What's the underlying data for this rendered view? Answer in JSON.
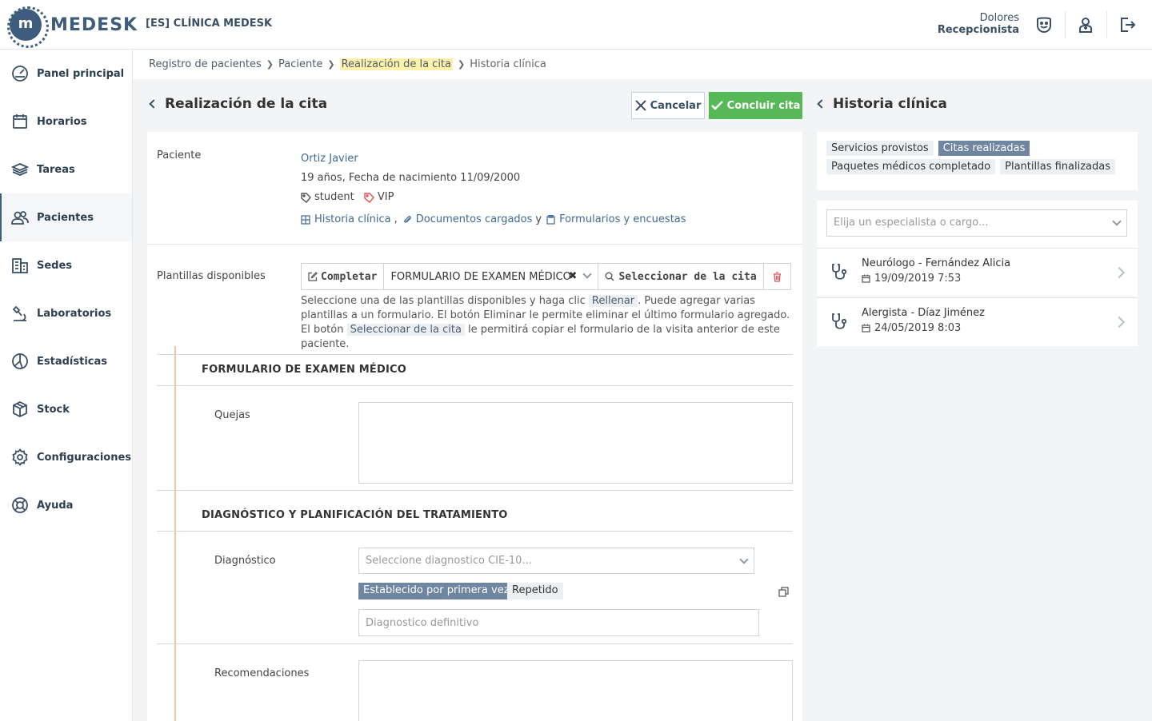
{
  "brand": {
    "logo_text": "MEDESK",
    "logo_mark": "m"
  },
  "header": {
    "clinic": "[ES] CLÍNICA MEDESK",
    "user_name": "Dolores",
    "user_role": "Recepcionista"
  },
  "sidebar": {
    "items": [
      {
        "label": "Panel principal",
        "icon": "dashboard-icon"
      },
      {
        "label": "Horarios",
        "icon": "calendar-icon"
      },
      {
        "label": "Tareas",
        "icon": "layers-icon"
      },
      {
        "label": "Pacientes",
        "icon": "patients-icon",
        "active": true
      },
      {
        "label": "Sedes",
        "icon": "buildings-icon"
      },
      {
        "label": "Laboratorios",
        "icon": "lab-icon"
      },
      {
        "label": "Estadísticas",
        "icon": "stats-icon"
      },
      {
        "label": "Stock",
        "icon": "box-icon"
      },
      {
        "label": "Configuraciones",
        "icon": "gear-icon"
      },
      {
        "label": "Ayuda",
        "icon": "lifebuoy-icon"
      }
    ]
  },
  "breadcrumb": [
    "Registro de pacientes",
    "Paciente",
    "Realización de la cita",
    "Historia clínica"
  ],
  "main": {
    "title": "Realización de la cita",
    "cancel_label": "Cancelar",
    "done_label": "Concluir cita",
    "patient_label": "Paciente",
    "patient_name": "Ortiz Javier",
    "patient_age": "19 años,",
    "patient_dob": "Fecha de nacimiento 11/09/2000",
    "tags": [
      "student",
      "VIP"
    ],
    "links": {
      "history": "Historia clínica",
      "comma": ",",
      "docs": "Documentos cargados",
      "and": "y",
      "forms": "Formularios y encuestas"
    },
    "templates_label": "Plantillas disponibles",
    "complete_btn": "Completar",
    "selected_template": "FORMULARIO DE EXAMEN MÉDICO",
    "select_from_visit_btn": "Seleccionar de la cita",
    "help": {
      "p1": "Seleccione una de las plantillas disponibles y haga clic ",
      "k1": "Rellenar",
      "p2": ". Puede agregar varias plantillas a un formulario. El botón Eliminar le permite eliminar el último formulario agregado. El botón ",
      "k2": "Seleccionar de la cita",
      "p3": " le permitirá copiar el formulario de la visita anterior de este paciente."
    },
    "section1_title": "FORMULARIO DE EXAMEN MÉDICO",
    "complaints_label": "Quejas",
    "section2_title": "DIAGNÓSTICO Y PLANIFICACIÓN DEL TRATAMIENTO",
    "diagnosis_label": "Diagnóstico",
    "diagnosis_placeholder": "Seleccione diagnostico CIE-10...",
    "toggle_first": "Establecido por primera vez",
    "toggle_repeat": "Repetido",
    "definitive_placeholder": "Diagnostico definitivo",
    "recommendations_label": "Recomendaciones"
  },
  "history": {
    "title": "Historia clínica",
    "filters": [
      {
        "label": "Servicios provistos",
        "active": false
      },
      {
        "label": "Citas realizadas",
        "active": true
      },
      {
        "label": "Paquetes médicos completado",
        "active": false
      },
      {
        "label": "Plantillas finalizadas",
        "active": false
      }
    ],
    "specialist_placeholder": "Elija un especialista o cargo...",
    "visits": [
      {
        "name": "Neurólogo - Fernández Alicia",
        "date": "19/09/2019 7:53"
      },
      {
        "name": "Alergista - Díaz Jiménez",
        "date": "24/05/2019 8:03"
      }
    ]
  },
  "colors": {
    "brand": "#3e5c7c",
    "success": "#56b856",
    "chip_active": "#6f86a0",
    "highlight": "#fff2a8"
  }
}
